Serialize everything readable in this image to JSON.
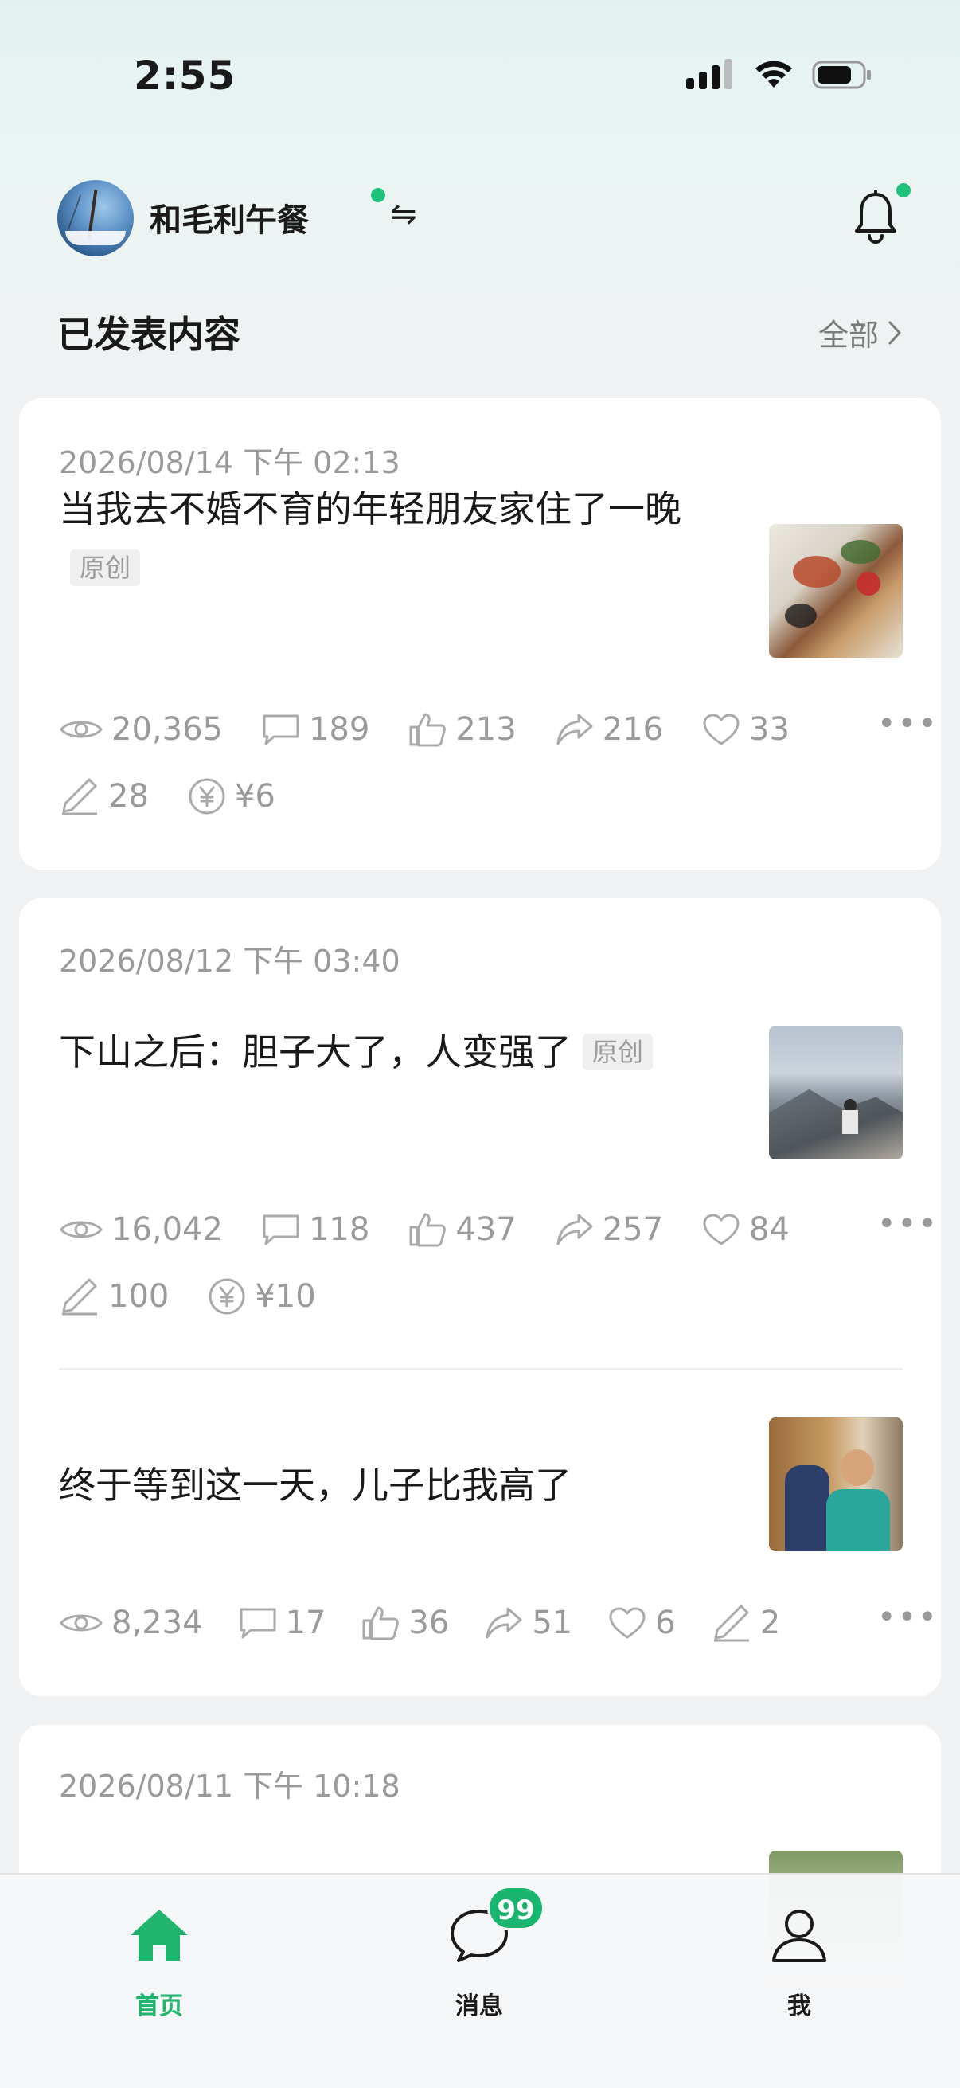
{
  "status_bar": {
    "time": "2:55"
  },
  "account": {
    "name": "和毛利午餐",
    "switch_symbol": "⇋"
  },
  "section": {
    "title": "已发表内容",
    "all_label": "全部"
  },
  "posts": [
    {
      "date": "2026/08/14 下午 02:13",
      "title": "当我去不婚不育的年轻朋友家住了一晚",
      "tag": "原创",
      "views": "20,365",
      "comments": "189",
      "likes": "213",
      "shares": "216",
      "favorites": "33",
      "writing": "28",
      "reward": "¥6",
      "more": "•••"
    },
    {
      "date": "2026/08/12 下午 03:40",
      "title": "下山之后：胆子大了，人变强了",
      "tag": "原创",
      "views": "16,042",
      "comments": "118",
      "likes": "437",
      "shares": "257",
      "favorites": "84",
      "writing": "100",
      "reward": "¥10",
      "more": "•••"
    },
    {
      "title": "终于等到这一天，儿子比我高了",
      "views": "8,234",
      "comments": "17",
      "likes": "36",
      "shares": "51",
      "favorites": "6",
      "writing": "2",
      "more": "•••"
    },
    {
      "date": "2026/08/11 下午 10:18"
    }
  ],
  "tab_bar": {
    "home_label": "首页",
    "messages_label": "消息",
    "me_label": "我",
    "messages_badge": "99",
    "active_color": "#1fb56c"
  }
}
